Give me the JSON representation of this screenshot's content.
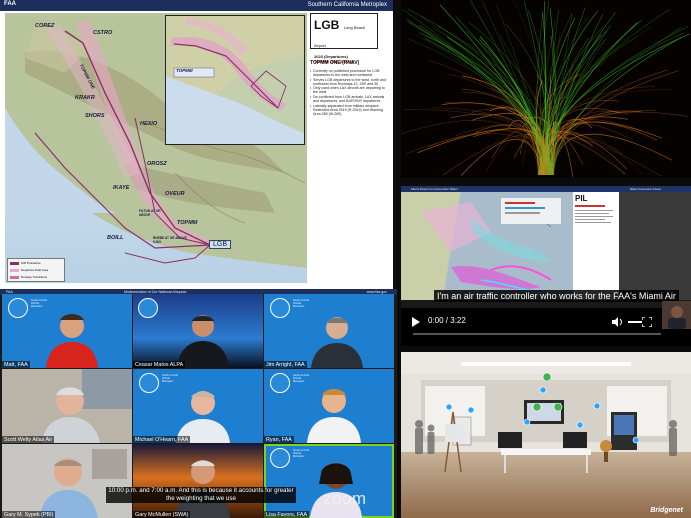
{
  "map_slide": {
    "header_left": "FAA",
    "header_title": "Southern California Metroplex",
    "waypoints": [
      "COREZ",
      "CSTRO",
      "TOPMM ONE",
      "KRAKR",
      "SHORS",
      "HEXIO",
      "OROSZ",
      "IKAYE",
      "OVEUR",
      "BOILL",
      "TOPMM",
      "LGB"
    ],
    "inset_label": "TOPMM",
    "fix_notes": [
      "FILTUN AT OR ABOVE",
      "RHEBE AT OR ABOVE 6,000"
    ],
    "legend": [
      "SID Procedure",
      "Departure Path Area",
      "Runway Transitions"
    ],
    "airport_code": "LGB",
    "airport_name": "Long Beach Airport",
    "departures": "2023 (Departures)",
    "procedure": "TOPMM ONE (RNAV)",
    "procedure_title": "TOPMM ONE (RNAV)",
    "bullets": [
      "Currently no published procedure for LGB departures to the west and northwest",
      "Serves LGB departures to the west, north and northwest from Runways 12, 25R and 30",
      "Only used when LAX aircraft are departing to the west",
      "De-conflicted from LGB arrivals, LAX arrivals and departures, and BUR/VNY departures",
      "Laterally separated from military airspace Restricted Area 2519 (R-2519) and Warning Area 289 (W-289)"
    ]
  },
  "flow_viz": {
    "colors": {
      "green": "#3ed12a",
      "orange": "#d9781c"
    }
  },
  "video": {
    "topbar_left": "Miami Flows from Ascension Miami",
    "topbar_right": "Miami Ascension Flows",
    "info_code": "PIL",
    "caption": "I'm an air traffic controller who works for the FAA's Miami Air",
    "time": "0:00 / 3:22",
    "progress": 0.0
  },
  "zoom": {
    "top_left": "FAA",
    "top_center": "Modernization of Our National Airspace",
    "top_right": "www.faa.gov",
    "seal_text": "South Central Florida Metroplex",
    "participants": [
      "Matt, FAA",
      "Ceasar Matos ALPA",
      "Jim Arright, FAA",
      "Scott Welty Atlas Air",
      "Michael O'Hearn, FAA",
      "Ryan, FAA",
      "Gary M. Sypek (PBI)",
      "Gary McMullen (SWA)",
      "Lisa Favors, FAA"
    ],
    "caption": "10:00 p.m. and 7:00 a.m. And this is because it accounts for greater the weighting that we use",
    "logo": "zoom"
  },
  "virtual_room": {
    "logo": "Bridgenet"
  }
}
